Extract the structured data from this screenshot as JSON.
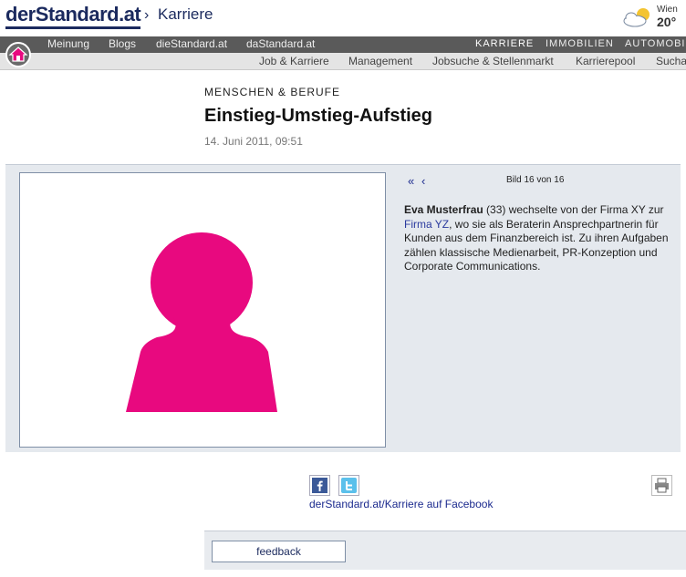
{
  "header": {
    "logo": "derStandard.at",
    "breadcrumb_sep": "›",
    "breadcrumb": "Karriere",
    "weather": {
      "city": "Wien",
      "temp": "20°"
    }
  },
  "nav_primary": [
    {
      "label": "Meinung"
    },
    {
      "label": "Blogs"
    },
    {
      "label": "dieStandard.at"
    },
    {
      "label": "daStandard.at"
    },
    {
      "label": "KARRIERE"
    },
    {
      "label": "IMMOBILIEN"
    },
    {
      "label": "AUTOMOBIL"
    }
  ],
  "nav_secondary": [
    {
      "label": "Job & Karriere"
    },
    {
      "label": "Management"
    },
    {
      "label": "Jobsuche & Stellenmarkt"
    },
    {
      "label": "Karrierepool"
    },
    {
      "label": "Sucha"
    }
  ],
  "article": {
    "section": "MENSCHEN & BERUFE",
    "title": "Einstieg-Umstieg-Aufstieg",
    "date": "14. Juni 2011, 09:51"
  },
  "gallery": {
    "first": "«",
    "prev": "‹",
    "counter": "Bild 16 von 16",
    "caption": {
      "name": "Eva Musterfrau",
      "text1": " (33) wechselte von der Firma XY zur ",
      "link": "Firma YZ",
      "text2": ", wo sie als Beraterin Ansprechpartnerin für Kunden aus dem Finanzbereich ist. Zu ihren Aufgaben zählen klassische Medienarbeit, PR-Konzeption und Corporate Communications."
    },
    "silhouette_color": "#e8097f"
  },
  "social": {
    "facebook_link": "derStandard.at/Karriere auf Facebook"
  },
  "feedback_label": "feedback"
}
